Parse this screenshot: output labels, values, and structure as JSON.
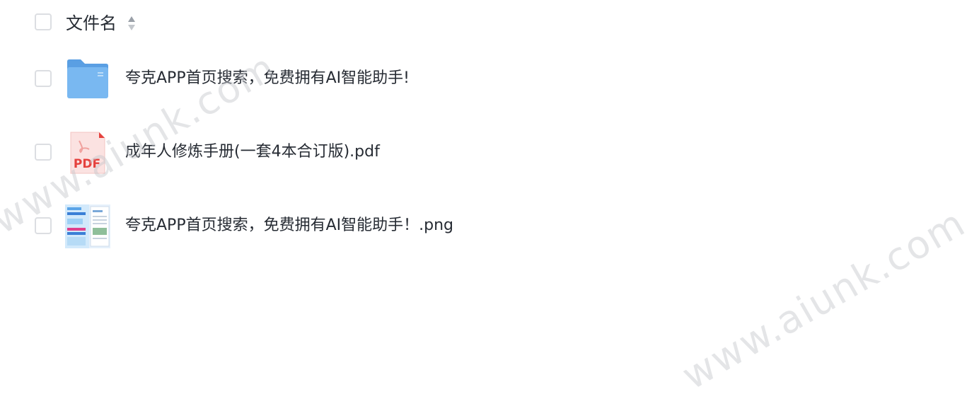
{
  "header": {
    "select_all": false,
    "title": "文件名",
    "sort_icon": "sort-icon"
  },
  "files": [
    {
      "name": "夸克APP首页搜索，免费拥有AI智能助手!",
      "type": "folder",
      "icon": "folder-icon",
      "checked": false
    },
    {
      "name": "成年人修炼手册(一套4本合订版).pdf",
      "type": "pdf",
      "icon": "pdf-icon",
      "icon_label": "PDF",
      "checked": false
    },
    {
      "name": "夸克APP首页搜索，免费拥有AI智能助手！.png",
      "type": "image",
      "icon": "image-thumbnail-icon",
      "checked": false
    }
  ],
  "watermark": {
    "text": "www.aiunk.com"
  },
  "colors": {
    "folder": "#6fb0ec",
    "pdf_accent": "#e5413d",
    "checkbox_border": "#dcdee2"
  }
}
